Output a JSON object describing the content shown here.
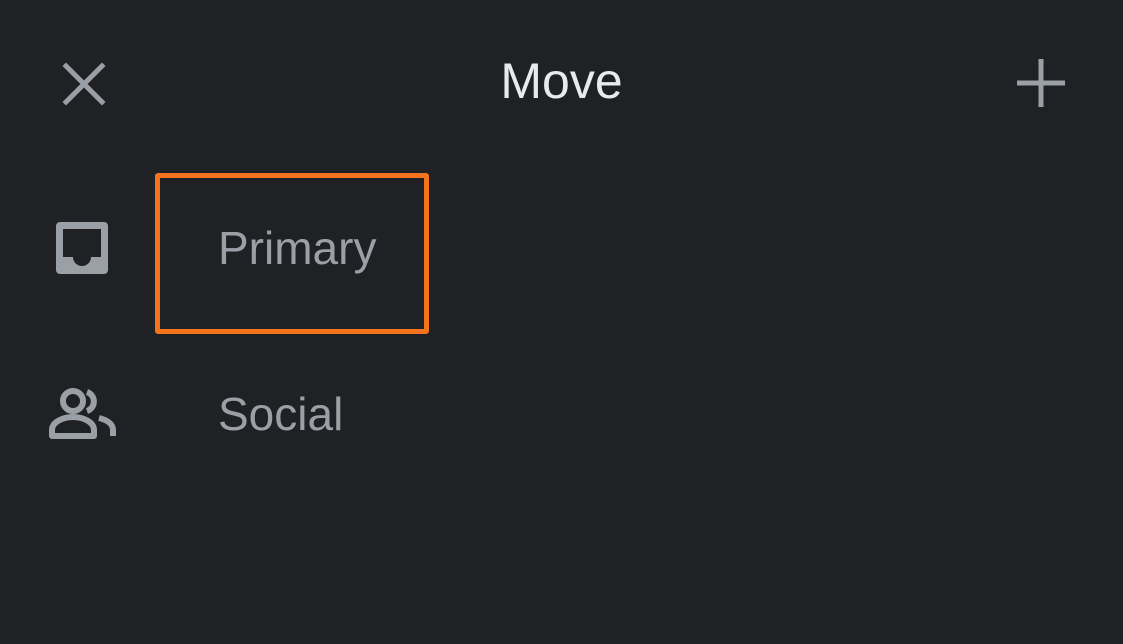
{
  "header": {
    "title": "Move",
    "close_icon": "close-icon",
    "add_icon": "plus-icon"
  },
  "labels": [
    {
      "id": "primary",
      "label": "Primary",
      "icon": "inbox-icon",
      "highlighted": true
    },
    {
      "id": "social",
      "label": "Social",
      "icon": "people-icon",
      "highlighted": false
    }
  ],
  "colors": {
    "background": "#202124",
    "title_text": "#e8eaed",
    "label_text": "#9aa0a6",
    "icon": "#9aa0a6",
    "highlight_border": "#f5731c"
  }
}
